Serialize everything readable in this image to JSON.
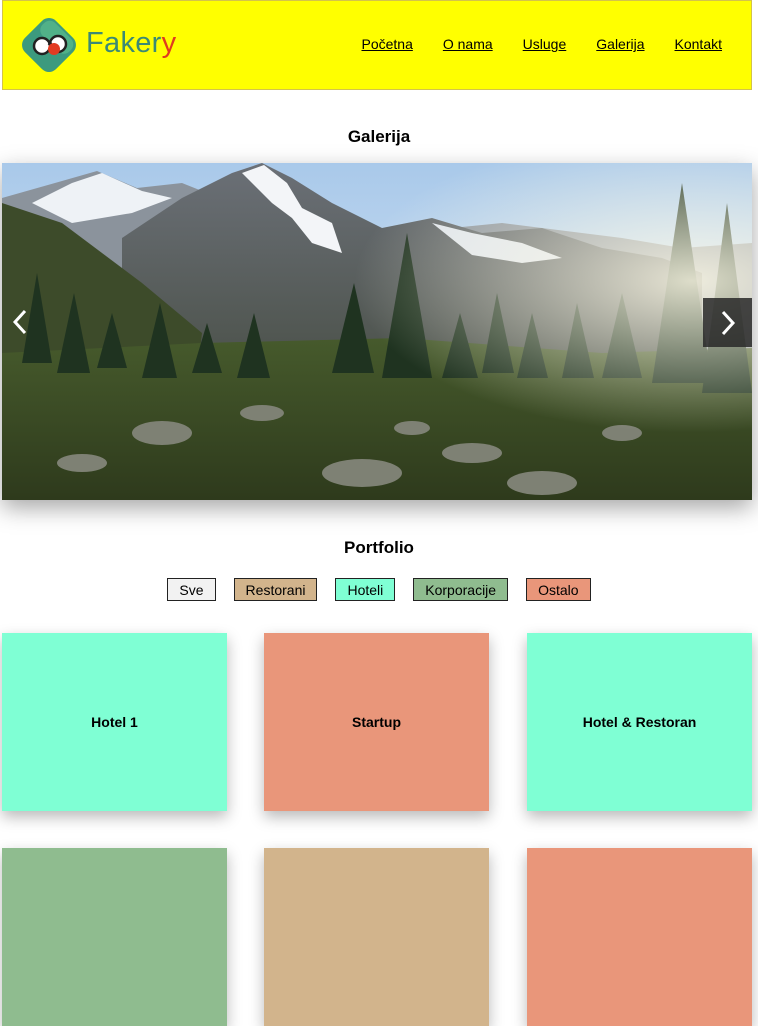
{
  "header": {
    "logo_text_main": "Faker",
    "logo_text_accent": "y",
    "nav": [
      "Početna",
      "O nama",
      "Usluge",
      "Galerija",
      "Kontakt"
    ]
  },
  "gallery": {
    "title": "Galerija"
  },
  "portfolio": {
    "title": "Portfolio",
    "filters": [
      {
        "label": "Sve",
        "color": "#f2f2f2"
      },
      {
        "label": "Restorani",
        "color": "#d2b48c"
      },
      {
        "label": "Hoteli",
        "color": "#7fffd4"
      },
      {
        "label": "Korporacije",
        "color": "#8fbc8f"
      },
      {
        "label": "Ostalo",
        "color": "#e9967a"
      }
    ],
    "items": [
      {
        "label": "Hotel 1",
        "color": "#7fffd4"
      },
      {
        "label": "Startup",
        "color": "#e9967a"
      },
      {
        "label": "Hotel & Restoran",
        "color": "#7fffd4"
      },
      {
        "label": "",
        "color": "#8fbc8f"
      },
      {
        "label": "",
        "color": "#d2b48c"
      },
      {
        "label": "",
        "color": "#e9967a"
      }
    ]
  },
  "colors": {
    "header_bg": "#ffff00",
    "logo_text": "#3c8a74",
    "logo_accent": "#e03b1f"
  },
  "icons": {
    "prev": "chevron-left-icon",
    "next": "chevron-right-icon"
  }
}
